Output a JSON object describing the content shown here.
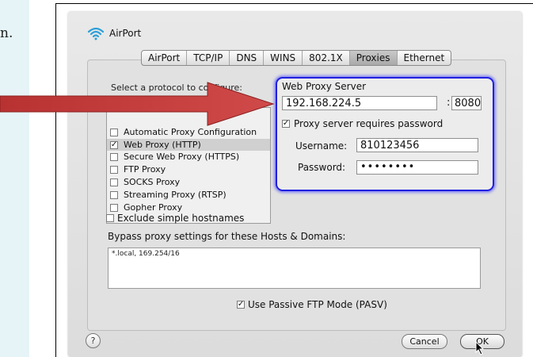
{
  "page": {
    "left_fragment": "n."
  },
  "window": {
    "title": "AirPort"
  },
  "tabs": [
    {
      "label": "AirPort"
    },
    {
      "label": "TCP/IP"
    },
    {
      "label": "DNS"
    },
    {
      "label": "WINS"
    },
    {
      "label": "802.1X"
    },
    {
      "label": "Proxies",
      "active": true
    },
    {
      "label": "Ethernet"
    }
  ],
  "protocols": {
    "label": "Select a protocol to configure:",
    "items": [
      {
        "label": "Automatic Proxy Configuration",
        "checked": false
      },
      {
        "label": "Web Proxy (HTTP)",
        "checked": true,
        "selected": true
      },
      {
        "label": "Secure Web Proxy (HTTPS)",
        "checked": false
      },
      {
        "label": "FTP Proxy",
        "checked": false
      },
      {
        "label": "SOCKS Proxy",
        "checked": false
      },
      {
        "label": "Streaming Proxy (RTSP)",
        "checked": false
      },
      {
        "label": "Gopher Proxy",
        "checked": false
      }
    ]
  },
  "proxy_server": {
    "title": "Web Proxy Server",
    "server": "192.168.224.5",
    "colon": ":",
    "port": "8080",
    "requires_password_label": "Proxy server requires password",
    "requires_password": true,
    "username_label": "Username:",
    "username": "810123456",
    "password_label": "Password:",
    "password": "••••••••"
  },
  "options": {
    "exclude_label": "Exclude simple hostnames",
    "bypass_label": "Bypass proxy settings for these Hosts & Domains:",
    "bypass_value": "*.local, 169.254/16",
    "pasv_label": "Use Passive FTP Mode (PASV)"
  },
  "buttons": {
    "help": "?",
    "cancel": "Cancel",
    "ok": "OK"
  },
  "colors": {
    "highlight_border": "#2020e0",
    "arrow": "#c23b3b"
  }
}
